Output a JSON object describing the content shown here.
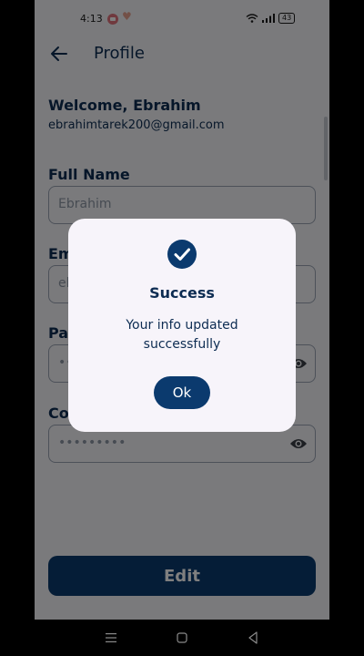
{
  "statusbar": {
    "time": "4:13",
    "battery": "43"
  },
  "appbar": {
    "title": "Profile"
  },
  "profile": {
    "welcome": "Welcome, Ebrahim",
    "email": "ebrahimtarek200@gmail.com"
  },
  "form": {
    "full_name_label": "Full Name",
    "full_name_value": "Ebrahim",
    "email_label": "Em",
    "email_value": "el",
    "password_label": "Pa",
    "password_value": "••",
    "confirm_label": "Co",
    "confirm_value": "•••••••••"
  },
  "edit_label": "Edit",
  "dialog": {
    "title": "Success",
    "message": "Your info updated successfully",
    "ok_label": "Ok"
  },
  "colors": {
    "primary": "#0b3a6e",
    "text": "#0d2c52"
  }
}
